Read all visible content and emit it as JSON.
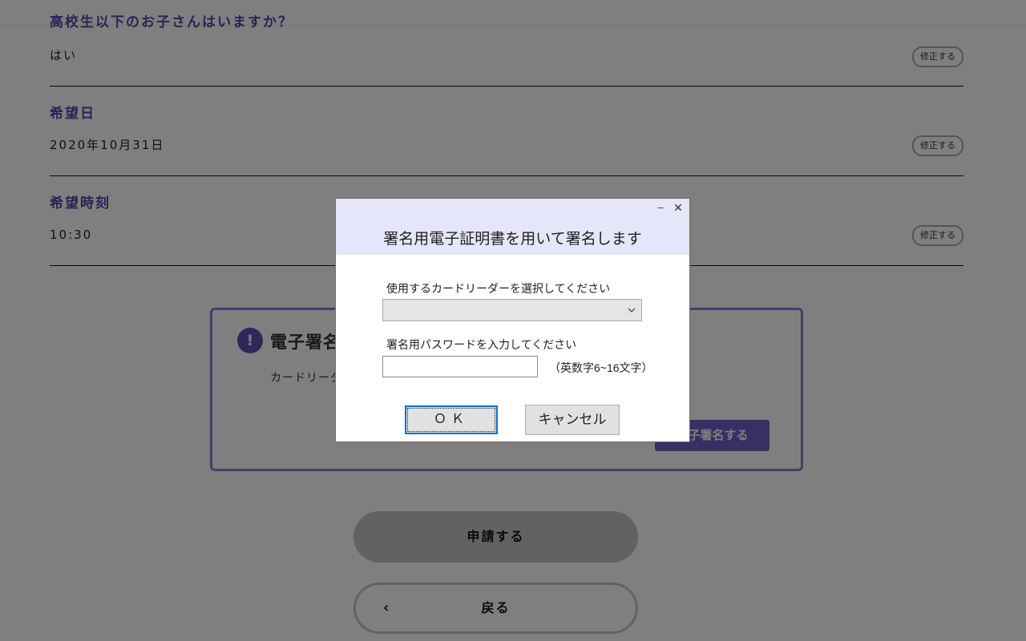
{
  "background": {
    "partial_question": "高校生以下のお子さんはいますか？",
    "rows": [
      {
        "label": "",
        "value": "はい",
        "edit": "修正する"
      },
      {
        "label": "希望日",
        "value": "2020年10月31日",
        "edit": "修正する"
      },
      {
        "label": "希望時刻",
        "value": "10:30",
        "edit": "修正する"
      }
    ],
    "sign_box": {
      "icon": "!",
      "title": "電子署名",
      "text": "カードリーダー",
      "action": "電子署名する"
    },
    "apply_button": "申請する",
    "back_button": "戻る",
    "back_chevron": "‹"
  },
  "dialog": {
    "minimize_glyph": "–",
    "close_glyph": "✕",
    "title": "署名用電子証明書を用いて署名します",
    "reader_label": "使用するカードリーダーを選択してください",
    "reader_value": "",
    "password_label": "署名用パスワードを入力してください",
    "password_value": "",
    "password_hint": "（英数字6~16文字）",
    "ok_label": "ＯＫ",
    "cancel_label": "キャンセル"
  },
  "colors": {
    "accent": "#5546a8",
    "overlay": "rgba(0,0,0,0.5)",
    "dialog_header": "#e6e6fa",
    "focus_border": "#0a6fd1"
  }
}
